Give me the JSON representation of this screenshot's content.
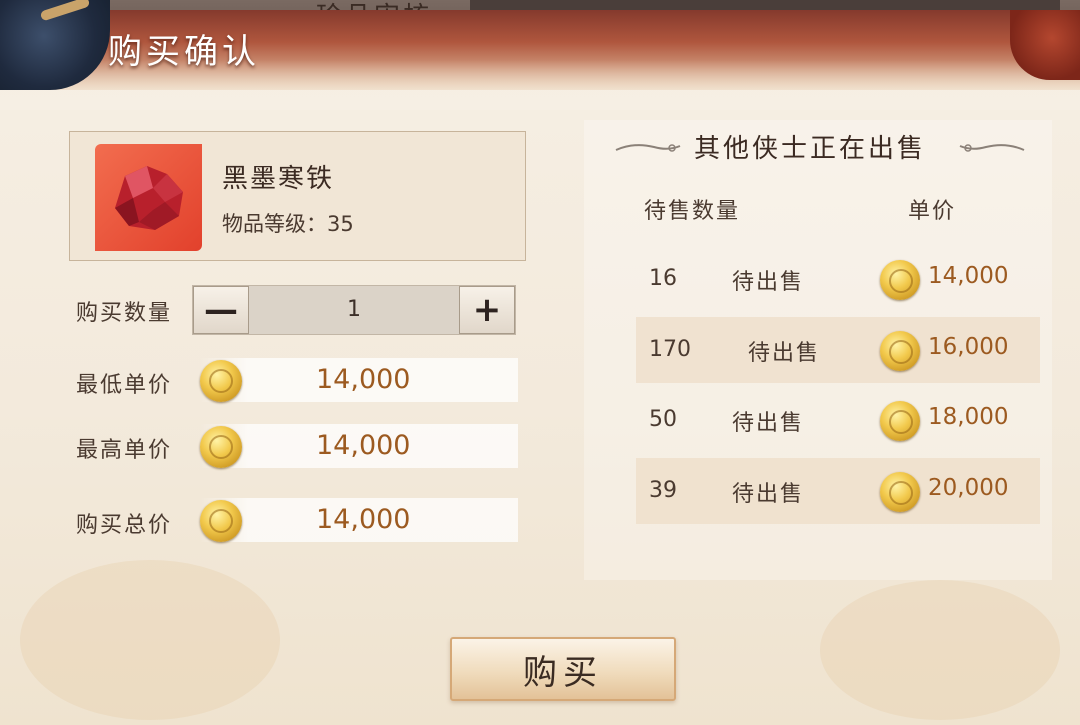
{
  "background": {
    "tab_title": "珍品审核"
  },
  "dialog": {
    "title": "购买确认",
    "buy_button_label": "购买"
  },
  "item": {
    "name": "黑墨寒铁",
    "level_label": "物品等级：",
    "level_value": "35",
    "icon": "red-ore-icon"
  },
  "purchase": {
    "quantity_label": "购买数量",
    "quantity_value": "1",
    "decrease_symbol": "—",
    "increase_symbol": "+",
    "min_price_label": "最低单价",
    "min_price_value": "14,000",
    "max_price_label": "最高单价",
    "max_price_value": "14,000",
    "total_price_label": "购买总价",
    "total_price_value": "14,000",
    "currency_icon": "gold-coin-icon"
  },
  "sellers": {
    "title": "其他侠士正在出售",
    "col_quantity": "待售数量",
    "col_price": "单价",
    "rows": [
      {
        "quantity": "16",
        "status": "待出售",
        "price": "14,000"
      },
      {
        "quantity": "170",
        "status": "待出售",
        "price": "16,000"
      },
      {
        "quantity": "50",
        "status": "待出售",
        "price": "18,000"
      },
      {
        "quantity": "39",
        "status": "待出售",
        "price": "20,000"
      }
    ]
  },
  "colors": {
    "price_text": "#9c5a20",
    "item_icon_bg": "#e2412c",
    "header_red": "#7b2a1d"
  }
}
